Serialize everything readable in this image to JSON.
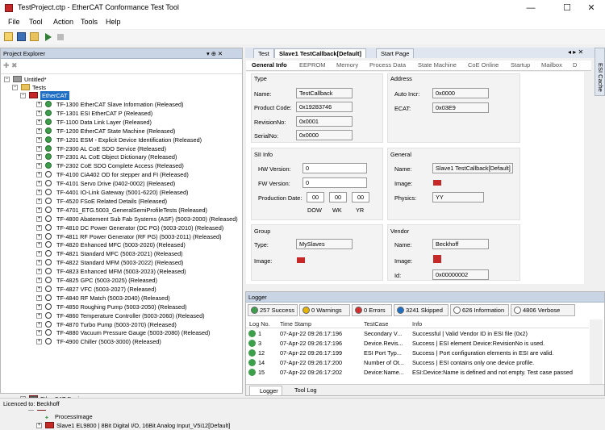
{
  "window": {
    "title": "TestProject.ctp - EtherCAT Conformance Test Tool",
    "min": "—",
    "max": "☐",
    "close": "✕"
  },
  "menu": [
    "File",
    "Tool",
    "Action",
    "Tools",
    "Help"
  ],
  "explorer": {
    "title": "Project Explorer",
    "pin": "▾ ⊕ ✕",
    "root": "Untitled*",
    "tests": "Tests",
    "ethercat": "EtherCAT",
    "items": [
      {
        "t": "TF-1300 EtherCAT Slave Information (Released)",
        "g": true
      },
      {
        "t": "TF-1301 ESI EtherCAT P (Released)",
        "g": true
      },
      {
        "t": "TF-1100 Data Link Layer (Released)",
        "g": true
      },
      {
        "t": "TF-1200 EtherCAT State Machine (Released)",
        "g": true
      },
      {
        "t": "TF-1201 ESM - Explicit Device Identification (Released)",
        "g": true
      },
      {
        "t": "TF-2300 AL CoE SDO Service (Released)",
        "g": true
      },
      {
        "t": "TF-2301 AL CoE Object Dictionary (Released)",
        "g": true
      },
      {
        "t": "TF-2302 CoE SDO Complete Access (Released)",
        "g": true
      },
      {
        "t": "TF-4100 CiA402 OD for stepper and FI (Released)",
        "g": false
      },
      {
        "t": "TF-4101 Servo Drive (0402-0002) (Released)",
        "g": false
      },
      {
        "t": "TF-4401 IO-Link Gateway (5001-6220) (Released)",
        "g": false
      },
      {
        "t": "TF-4520 FSoE Related Details (Released)",
        "g": false
      },
      {
        "t": "TF-4701_ETG.5003_GeneralSemiProfileTests (Released)",
        "g": false
      },
      {
        "t": "TF-4800 Abatement Sub Fab Systems (ASF) (5003-2000) (Released)",
        "g": false
      },
      {
        "t": "TF-4810 DC Power Generator (DC PG) (5003-2010) (Released)",
        "g": false
      },
      {
        "t": "TF-4811 RF Power Generator (RF PG) (5003-2011) (Released)",
        "g": false
      },
      {
        "t": "TF-4820 Enhanced MFC (5003-2020) (Released)",
        "g": false
      },
      {
        "t": "TF-4821 Standard MFC (5003-2021) (Released)",
        "g": false
      },
      {
        "t": "TF-4822 Standard MFM (5003-2022) (Released)",
        "g": false
      },
      {
        "t": "TF-4823 Enhanced MFM (5003-2023) (Released)",
        "g": false
      },
      {
        "t": "TF-4825 GPC (5003-2025) (Released)",
        "g": false
      },
      {
        "t": "TF-4827 VFC (5003-2027) (Released)",
        "g": false
      },
      {
        "t": "TF-4840 RF Match (5003-2040) (Released)",
        "g": false
      },
      {
        "t": "TF-4850 Roughing Pump (5003-2050) (Released)",
        "g": false
      },
      {
        "t": "TF-4860 Temperature Controller (5003-2060) (Released)",
        "g": false
      },
      {
        "t": "TF-4870 Turbo Pump (5003-2070) (Released)",
        "g": false
      },
      {
        "t": "TF-4880 Vacuum Pressure Gauge (5003-2080) (Released)",
        "g": false
      },
      {
        "t": "TF-4900 Chiller (5003-3000) (Released)",
        "g": false
      }
    ],
    "devices": "EtherCAT Devices",
    "dev_ecat": "EtherCAT",
    "process_image": "ProcessImage",
    "slave": "Slave1 EL9800 | 8Bit Digital I/O, 16Bit Analog Input_V5i12[Default]"
  },
  "doctabs": {
    "test": "Test",
    "slave": "Slave1 TestCallback[Default]",
    "start": "Start Page"
  },
  "subtabs": [
    "General Info",
    "EEPROM",
    "Memory",
    "Process Data",
    "State Machine",
    "CoE Online",
    "Startup",
    "Mailbox",
    "D"
  ],
  "general": {
    "type_h": "Type",
    "name_l": "Name:",
    "name_v": "TestCallback",
    "pc_l": "Product Code:",
    "pc_v": "0x19283746",
    "rev_l": "RevisionNo:",
    "rev_v": "0x0001",
    "ser_l": "SerialNo:",
    "ser_v": "0x0000",
    "addr_h": "Address",
    "ai_l": "Auto Incr:",
    "ai_v": "0x0000",
    "ecat_l": "ECAT:",
    "ecat_v": "0x03E9",
    "sii_h": "SII Info",
    "hw_l": "HW Version:",
    "hw_v": "0",
    "fw_l": "FW Version:",
    "fw_v": "0",
    "pd_l": "Production Date:",
    "dow": "00",
    "wk": "00",
    "yr": "00",
    "dow_l": "DOW",
    "wk_l": "WK",
    "yr_l": "YR",
    "gen_h": "General",
    "gname_l": "Name:",
    "gname_v": "Slave1 TestCallback[Default]",
    "img_l": "Image:",
    "phy_l": "Physics:",
    "phy_v": "YY",
    "grp_h": "Group",
    "gtype_l": "Type:",
    "gtype_v": "MySlaves",
    "gimg_l": "Image:",
    "ven_h": "Vendor",
    "vname_l": "Name:",
    "vname_v": "Beckhoff",
    "vimg_l": "Image:",
    "id_l": "Id:",
    "id_v": "0x00000002"
  },
  "side_tab": "ESI Cache",
  "logger": {
    "title": "Logger",
    "buttons": [
      {
        "label": "257 Success",
        "c": "#3d9e4b"
      },
      {
        "label": "0 Warnings",
        "c": "#e8b400"
      },
      {
        "label": "0 Errors",
        "c": "#d32f2f"
      },
      {
        "label": "3241 Skipped",
        "c": "#1e6fc4"
      },
      {
        "label": "626 Information",
        "c": "#ffffff"
      },
      {
        "label": "4806 Verbose",
        "c": "#ffffff"
      }
    ],
    "cols": [
      "Log No.",
      "Time Stamp",
      "TestCase",
      "Info"
    ],
    "rows": [
      [
        "1",
        "07-Apr-22 09:26:17:196",
        "Secondary V...",
        "Successful | Valid Vendor ID in ESI file (0x2)"
      ],
      [
        "3",
        "07-Apr-22 09:26:17:196",
        "Device.Revis...",
        "Success | ESI element Device:RevisionNo is used."
      ],
      [
        "12",
        "07-Apr-22 09:26:17:199",
        "ESI Port Typ...",
        "Success | Port configuration elements in ESI are valid."
      ],
      [
        "14",
        "07-Apr-22 09:26:17:200",
        "Number of Ot...",
        "Success | ESI contains only one device profile."
      ],
      [
        "15",
        "07-Apr-22 09:26:17:202",
        "Device:Name...",
        "ESI:Device:Name is defined and not empty. Test case passed"
      ]
    ],
    "tab1": "Logger",
    "tab2": "Tool Log"
  },
  "status": "Licenced to: Beckhoff"
}
